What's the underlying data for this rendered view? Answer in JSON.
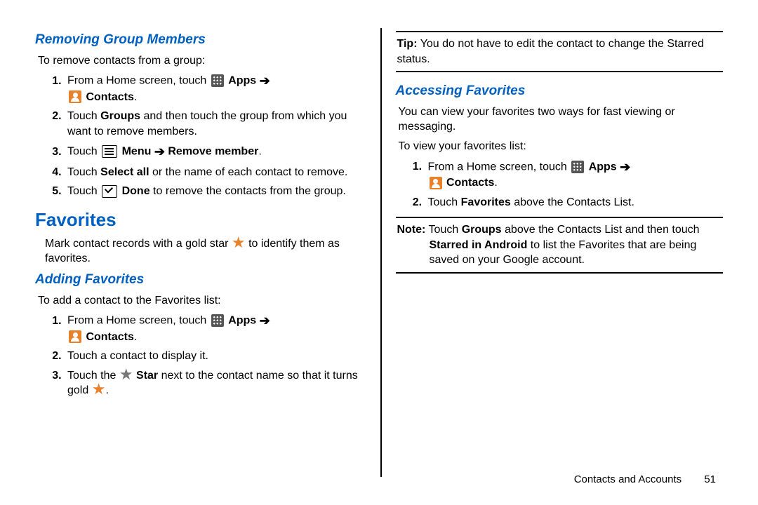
{
  "footer": {
    "section": "Contacts and Accounts",
    "page": "51"
  },
  "labels": {
    "apps": "Apps",
    "contacts": "Contacts",
    "menu": "Menu",
    "remove_member": "Remove member",
    "select_all": "Select all",
    "done": "Done",
    "star": "Star",
    "favorites_word": "Favorites",
    "groups": "Groups",
    "starred_android": "Starred in Android",
    "tip": "Tip:",
    "note": "Note:"
  },
  "left": {
    "removing_title": "Removing Group Members",
    "removing_intro": "To remove contacts from a group:",
    "removing_steps": {
      "s1a": "From a Home screen, touch ",
      "s2a": "Touch ",
      "s2b": " and then touch the group from which you want to remove members.",
      "s3a": "Touch ",
      "s4a": "Touch ",
      "s4b": " or the name of each contact to remove.",
      "s5a": "Touch ",
      "s5b": " to remove the contacts from the group."
    },
    "favorites_title": "Favorites",
    "favorites_intro_a": "Mark contact records with a gold star ",
    "favorites_intro_b": " to identify them as favorites.",
    "adding_title": "Adding Favorites",
    "adding_intro": "To add a contact to the Favorites list:",
    "adding_steps": {
      "s1a": "From a Home screen, touch ",
      "s2": "Touch a contact to display it.",
      "s3a": "Touch the ",
      "s3b": " next to the contact name so that it turns gold "
    }
  },
  "right": {
    "tip_text": " You do not have to edit the contact to change the Starred status.",
    "accessing_title": "Accessing Favorites",
    "accessing_intro1": "You can view your favorites two ways for fast viewing or messaging.",
    "accessing_intro2": "To view your favorites list:",
    "accessing_steps": {
      "s1a": "From a Home screen, touch ",
      "s2a": "Touch ",
      "s2b": " above the Contacts List."
    },
    "note_a": " Touch ",
    "note_b": " above the Contacts List and then touch ",
    "note_c": " to list the Favorites that are being saved on your Google account."
  }
}
